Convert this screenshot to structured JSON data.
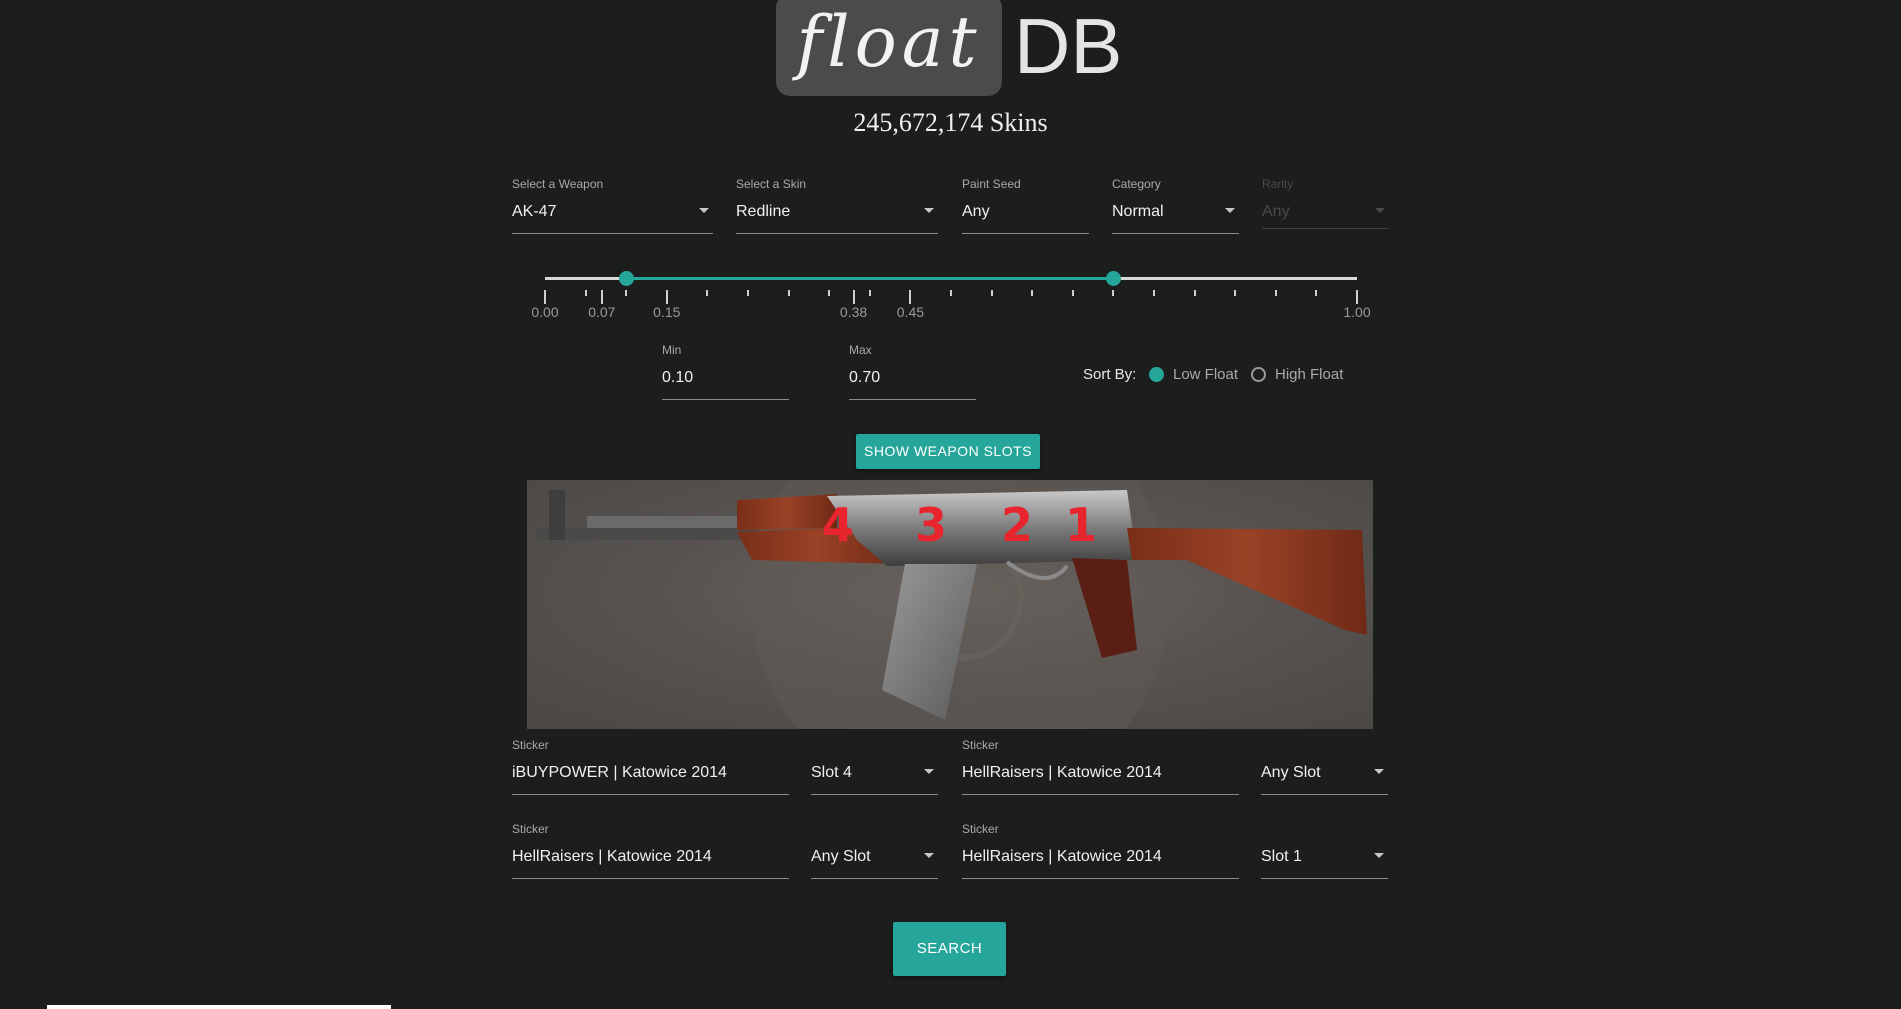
{
  "header": {
    "logo_float": "float",
    "logo_db": "DB",
    "skin_count": "245,672,174 Skins"
  },
  "filters": {
    "weapon": {
      "label": "Select a Weapon",
      "value": "AK-47"
    },
    "skin": {
      "label": "Select a Skin",
      "value": "Redline"
    },
    "paint_seed": {
      "label": "Paint Seed",
      "value": "Any"
    },
    "category": {
      "label": "Category",
      "value": "Normal"
    },
    "rarity": {
      "label": "Rarity",
      "value": "Any"
    }
  },
  "float_slider": {
    "min_value": 0.1,
    "max_value": 0.7,
    "tick_labels": [
      "0.00",
      "0.07",
      "0.15",
      "0.38",
      "0.45",
      "1.00"
    ]
  },
  "range_inputs": {
    "min": {
      "label": "Min",
      "value": "0.10"
    },
    "max": {
      "label": "Max",
      "value": "0.70"
    }
  },
  "sort": {
    "label": "Sort By:",
    "options": [
      "Low Float",
      "High Float"
    ],
    "selected": "Low Float"
  },
  "buttons": {
    "show_slots": "SHOW WEAPON SLOTS",
    "search": "SEARCH"
  },
  "weapon_slots": [
    "4",
    "3",
    "2",
    "1"
  ],
  "stickers": [
    {
      "label": "Sticker",
      "value": "iBUYPOWER | Katowice 2014",
      "slot": "Slot 4"
    },
    {
      "label": "Sticker",
      "value": "HellRaisers | Katowice 2014",
      "slot": "Any Slot"
    },
    {
      "label": "Sticker",
      "value": "HellRaisers | Katowice 2014",
      "slot": "Any Slot"
    },
    {
      "label": "Sticker",
      "value": "HellRaisers | Katowice 2014",
      "slot": "Slot 1"
    }
  ],
  "colors": {
    "accent": "#26a69a",
    "background": "#1c1d1d",
    "slot_number": "#e8242c"
  }
}
